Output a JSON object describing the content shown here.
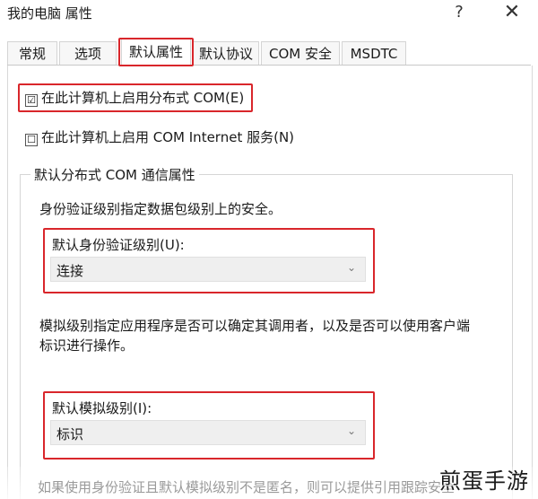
{
  "window": {
    "title": "我的电脑 属性",
    "help_label": "?",
    "close_label": "✕"
  },
  "tabs": [
    {
      "label": "常规",
      "active": false
    },
    {
      "label": "选项",
      "active": false
    },
    {
      "label": "默认属性",
      "active": true
    },
    {
      "label": "默认协议",
      "active": false
    },
    {
      "label": "COM 安全",
      "active": false
    },
    {
      "label": "MSDTC",
      "active": false
    }
  ],
  "options": {
    "enable_dcom": {
      "label": "在此计算机上启用分布式 COM(E)",
      "checked": true,
      "mark": "☑"
    },
    "enable_com_internet": {
      "label": "在此计算机上启用 COM Internet 服务(N)",
      "checked": false,
      "mark": "☐"
    }
  },
  "group": {
    "title": "默认分布式 COM 通信属性",
    "auth_desc": "身份验证级别指定数据包级别上的安全。",
    "auth_label": "默认身份验证级别(U):",
    "auth_value": "连接",
    "impersonation_desc_line1": "模拟级别指定应用程序是否可以确定其调用者，以及是否可以使用客户端",
    "impersonation_desc_line2": "标识进行操作。",
    "impersonation_label": "默认模拟级别(I):",
    "impersonation_value": "标识",
    "footer_partial": "如果使用身份验证且默认模拟级别不是匿名，则可以提供引用跟踪安全"
  },
  "chevron": "⌄",
  "watermark": "煎蛋手游",
  "colors": {
    "highlight_border": "#d9262b",
    "dropdown_bg": "#efefef"
  }
}
